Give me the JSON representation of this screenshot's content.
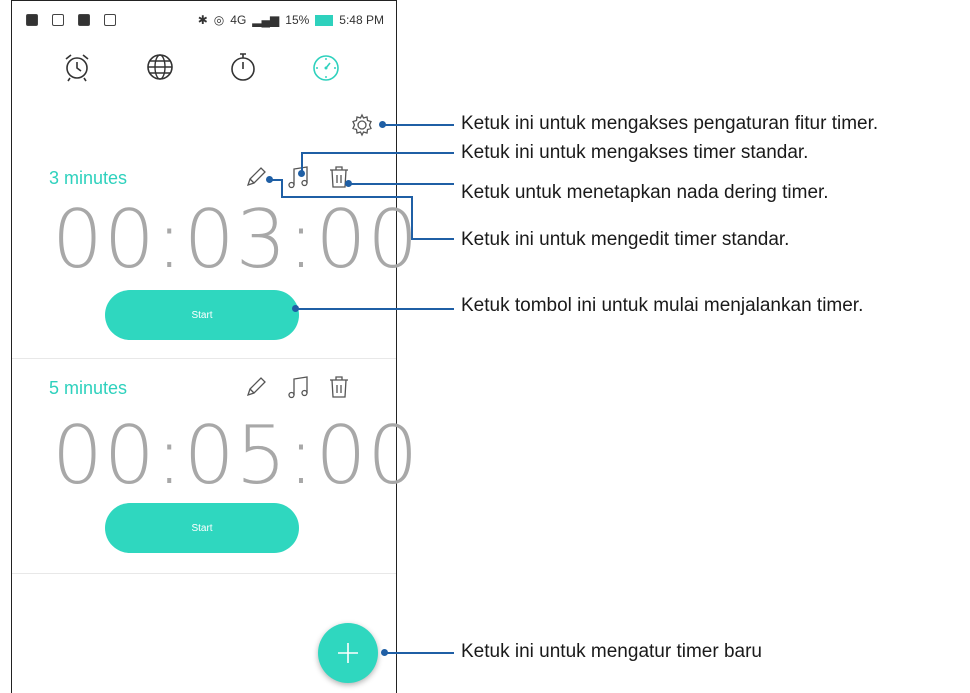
{
  "statusbar": {
    "network": "4G",
    "battery": "15%",
    "time": "5:48 PM"
  },
  "tabs": [
    "alarm-icon",
    "world-clock-icon",
    "stopwatch-icon",
    "timer-icon"
  ],
  "active_tab_color": "#2ed1bd",
  "timers": [
    {
      "name": "3 minutes",
      "time": "00:03:00",
      "start_label": "Start"
    },
    {
      "name": "5 minutes",
      "time": "00:05:00",
      "start_label": "Start"
    }
  ],
  "callouts": {
    "settings": "Ketuk ini untuk mengakses pengaturan fitur timer.",
    "music": "Ketuk ini untuk mengakses timer standar.",
    "delete": "Ketuk untuk menetapkan nada dering timer.",
    "edit": "Ketuk ini untuk mengedit timer standar.",
    "start": "Ketuk tombol ini untuk mulai menjalankan timer.",
    "add": "Ketuk ini untuk mengatur timer baru"
  },
  "colors": {
    "accent": "#2fd7bf",
    "callout_line": "#1f5fa5",
    "time_digits": "#a8a8a8"
  }
}
